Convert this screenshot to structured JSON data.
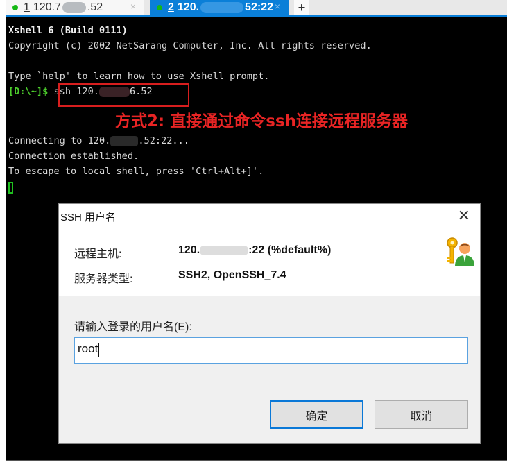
{
  "tabs": [
    {
      "number": "1",
      "label_prefix": "120.7",
      "label_suffix": ".52",
      "status_color": "#14b814",
      "active": false,
      "close": "×"
    },
    {
      "number": "2",
      "label_prefix": "120.",
      "label_suffix": "52:22",
      "status_color": "#14b814",
      "active": true,
      "close": "×"
    }
  ],
  "new_tab_label": "+",
  "terminal": {
    "line1": "Xshell 6 (Build 0111)",
    "line2": "Copyright (c) 2002 NetSarang Computer, Inc. All rights reserved.",
    "line3": "Type `help' to learn how to use Xshell prompt.",
    "prompt": "[D:\\~]$",
    "command_prefix": " ssh 120.",
    "command_suffix": "6.52",
    "annotation": "方式2: 直接通过命令ssh连接远程服务器",
    "line5_prefix": "Connecting to 120.",
    "line5_suffix": ".52:22...",
    "line6": "Connection established.",
    "line7": "To escape to local shell, press 'Ctrl+Alt+]'."
  },
  "dialog": {
    "title": "SSH 用户名",
    "close_label": "✕",
    "remote_host_label": "远程主机:",
    "remote_host_prefix": "120.",
    "remote_host_suffix": ":22 (%default%)",
    "server_type_label": "服务器类型:",
    "server_type_value": "SSH2, OpenSSH_7.4",
    "input_label": "请输入登录的用户名(E):",
    "username_value": "root",
    "ok_label": "确定",
    "cancel_label": "取消"
  }
}
